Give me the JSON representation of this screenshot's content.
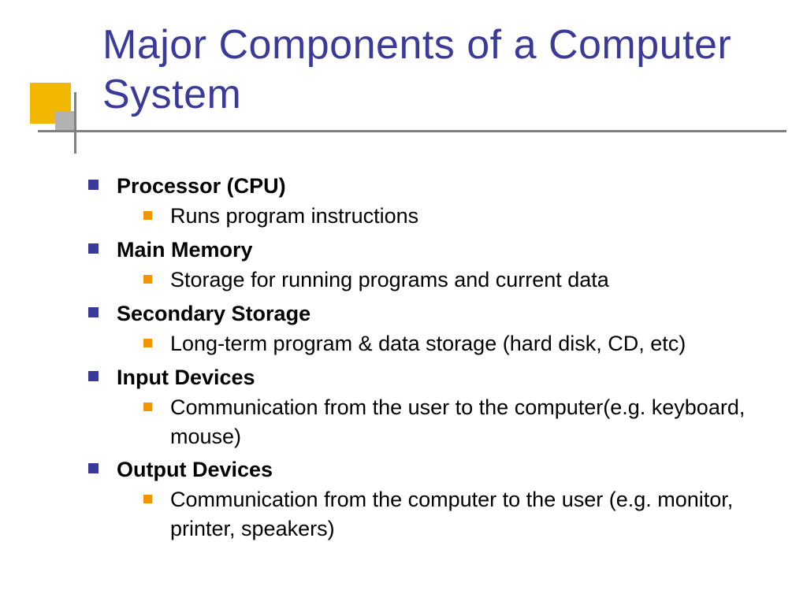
{
  "title": "Major Components of a Computer System",
  "items": [
    {
      "heading": "Processor (CPU)",
      "sub": [
        "Runs program instructions"
      ]
    },
    {
      "heading": "Main Memory",
      "sub": [
        "Storage for running programs and current data"
      ]
    },
    {
      "heading": "Secondary Storage",
      "sub": [
        "Long-term program & data storage (hard disk, CD, etc)"
      ]
    },
    {
      "heading": "Input Devices",
      "sub": [
        "Communication from the user to the computer(e.g. keyboard, mouse)"
      ]
    },
    {
      "heading": "Output Devices",
      "sub": [
        "Communication from the computer to the user (e.g. monitor, printer, speakers)"
      ]
    }
  ]
}
